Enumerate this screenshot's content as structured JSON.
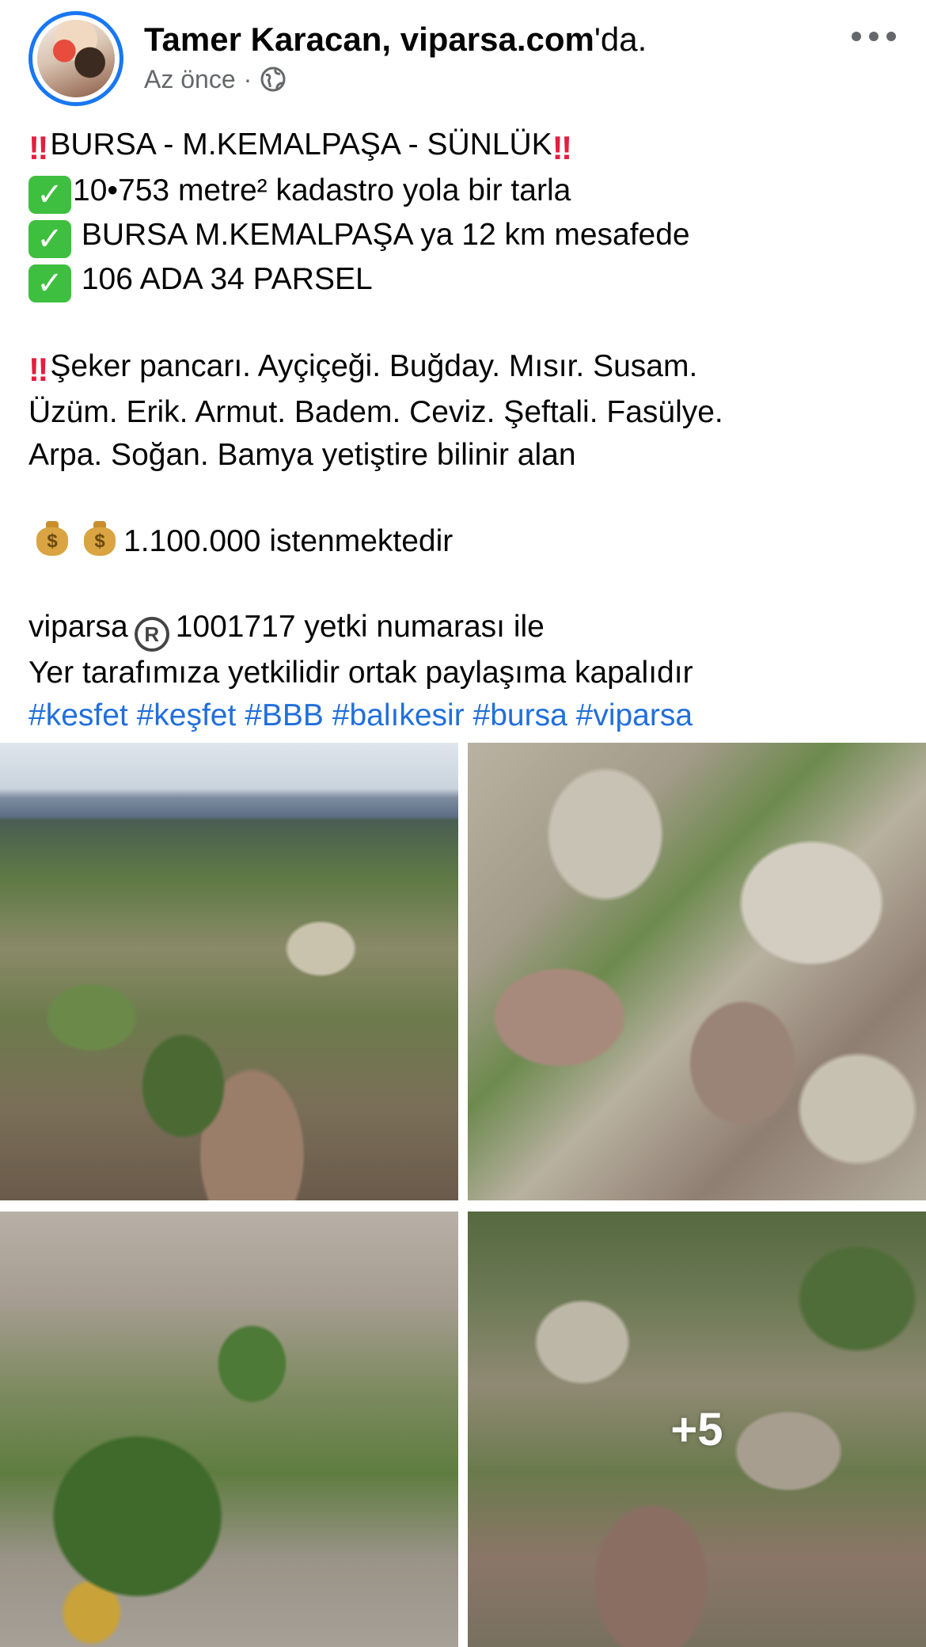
{
  "post": {
    "author": "Tamer Karacan, viparsa.com",
    "author_suffix": "'da.",
    "timestamp": "Az önce",
    "separator": "·",
    "privacy_icon": "globe-icon",
    "menu_icon": "more-options-icon"
  },
  "body": {
    "l1": "BURSA - M.KEMALPAŞA - SÜNLÜK",
    "l2": "10•753 metre² kadastro yola bir tarla",
    "l3": " BURSA M.KEMALPAŞA ya 12 km mesafede",
    "l4": " 106 ADA 34  PARSEL",
    "l5": "Şeker pancarı. Ayçiçeği. Buğday. Mısır. Susam.",
    "l6": "Üzüm. Erik. Armut. Badem. Ceviz. Şeftali. Fasülye.",
    "l7": "Arpa. Soğan. Bamya yetiştire bilinir alan",
    "l8": "1.100.000  istenmektedir",
    "l9a": "viparsa",
    "l9b": "1001717 yetki numarası ile",
    "l10": "Yer tarafımıza yetkilidir ortak paylaşıma kapalıdır",
    "hashtags": [
      "#kesfet",
      "#keşfet",
      "#BBB",
      "#balıkesir",
      "#bursa",
      "#viparsa"
    ]
  },
  "emoji": {
    "bang": "‼",
    "check": "✓",
    "dollar": "$",
    "registered": "R"
  },
  "photos": {
    "more_count": "+5"
  },
  "colors": {
    "accent": "#1877f2",
    "hashtag": "#216fdb",
    "meta_text": "#65676b",
    "check_green": "#3fbf3f",
    "bang_red": "#e41e3f"
  }
}
